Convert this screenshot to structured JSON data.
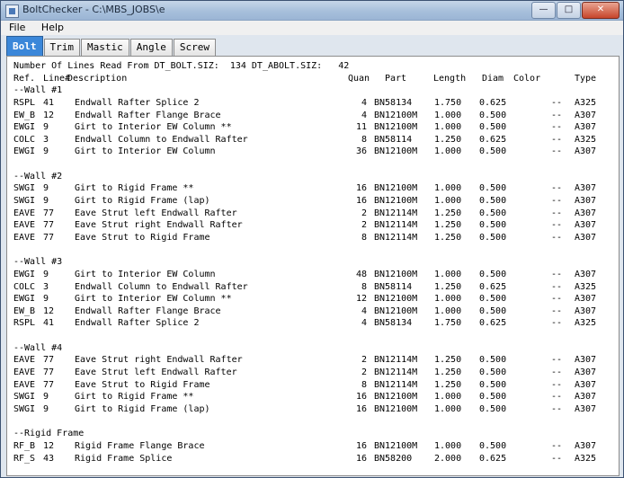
{
  "window": {
    "title": "BoltChecker - C:\\MBS_JOBS\\e"
  },
  "menu": [
    "File",
    "Help"
  ],
  "tabs": [
    "Bolt",
    "Trim",
    "Mastic",
    "Angle",
    "Screw"
  ],
  "info_line": "Number Of Lines Read From DT_BOLT.SIZ:  134 DT_ABOLT.SIZ:   42",
  "headers": {
    "ref": "Ref.",
    "line": "Line#",
    "desc": "Description",
    "quan": "Quan",
    "part": "Part",
    "length": "Length",
    "diam": "Diam",
    "color": "Color",
    "type": "Type"
  },
  "rows": [
    {
      "section": "--Wall #1"
    },
    {
      "ref": "RSPL",
      "line": "41",
      "desc": "Endwall Rafter Splice 2",
      "quan": "4",
      "part": "BN58134",
      "length": "1.750",
      "diam": "0.625",
      "color": "--",
      "type": "A325"
    },
    {
      "ref": "EW_B",
      "line": "12",
      "desc": "Endwall Rafter Flange Brace",
      "quan": "4",
      "part": "BN12100M",
      "length": "1.000",
      "diam": "0.500",
      "color": "--",
      "type": "A307"
    },
    {
      "ref": "EWGI",
      "line": "9",
      "desc": "Girt to Interior EW Column **",
      "quan": "11",
      "part": "BN12100M",
      "length": "1.000",
      "diam": "0.500",
      "color": "--",
      "type": "A307"
    },
    {
      "ref": "COLC",
      "line": "3",
      "desc": "Endwall Column to Endwall Rafter",
      "quan": "8",
      "part": "BN58114",
      "length": "1.250",
      "diam": "0.625",
      "color": "--",
      "type": "A325"
    },
    {
      "ref": "EWGI",
      "line": "9",
      "desc": "Girt to Interior EW Column",
      "quan": "36",
      "part": "BN12100M",
      "length": "1.000",
      "diam": "0.500",
      "color": "--",
      "type": "A307"
    },
    {
      "blank": true
    },
    {
      "section": "--Wall #2"
    },
    {
      "ref": "SWGI",
      "line": "9",
      "desc": "Girt to Rigid Frame **",
      "quan": "16",
      "part": "BN12100M",
      "length": "1.000",
      "diam": "0.500",
      "color": "--",
      "type": "A307"
    },
    {
      "ref": "SWGI",
      "line": "9",
      "desc": "Girt to Rigid Frame (lap)",
      "quan": "16",
      "part": "BN12100M",
      "length": "1.000",
      "diam": "0.500",
      "color": "--",
      "type": "A307"
    },
    {
      "ref": "EAVE",
      "line": "77",
      "desc": "Eave Strut left Endwall Rafter",
      "quan": "2",
      "part": "BN12114M",
      "length": "1.250",
      "diam": "0.500",
      "color": "--",
      "type": "A307"
    },
    {
      "ref": "EAVE",
      "line": "77",
      "desc": "Eave Strut right Endwall Rafter",
      "quan": "2",
      "part": "BN12114M",
      "length": "1.250",
      "diam": "0.500",
      "color": "--",
      "type": "A307"
    },
    {
      "ref": "EAVE",
      "line": "77",
      "desc": "Eave Strut to Rigid Frame",
      "quan": "8",
      "part": "BN12114M",
      "length": "1.250",
      "diam": "0.500",
      "color": "--",
      "type": "A307"
    },
    {
      "blank": true
    },
    {
      "section": "--Wall #3"
    },
    {
      "ref": "EWGI",
      "line": "9",
      "desc": "Girt to Interior EW Column",
      "quan": "48",
      "part": "BN12100M",
      "length": "1.000",
      "diam": "0.500",
      "color": "--",
      "type": "A307"
    },
    {
      "ref": "COLC",
      "line": "3",
      "desc": "Endwall Column to Endwall Rafter",
      "quan": "8",
      "part": "BN58114",
      "length": "1.250",
      "diam": "0.625",
      "color": "--",
      "type": "A325"
    },
    {
      "ref": "EWGI",
      "line": "9",
      "desc": "Girt to Interior EW Column **",
      "quan": "12",
      "part": "BN12100M",
      "length": "1.000",
      "diam": "0.500",
      "color": "--",
      "type": "A307"
    },
    {
      "ref": "EW_B",
      "line": "12",
      "desc": "Endwall Rafter Flange Brace",
      "quan": "4",
      "part": "BN12100M",
      "length": "1.000",
      "diam": "0.500",
      "color": "--",
      "type": "A307"
    },
    {
      "ref": "RSPL",
      "line": "41",
      "desc": "Endwall Rafter Splice 2",
      "quan": "4",
      "part": "BN58134",
      "length": "1.750",
      "diam": "0.625",
      "color": "--",
      "type": "A325"
    },
    {
      "blank": true
    },
    {
      "section": "--Wall #4"
    },
    {
      "ref": "EAVE",
      "line": "77",
      "desc": "Eave Strut right Endwall Rafter",
      "quan": "2",
      "part": "BN12114M",
      "length": "1.250",
      "diam": "0.500",
      "color": "--",
      "type": "A307"
    },
    {
      "ref": "EAVE",
      "line": "77",
      "desc": "Eave Strut left Endwall Rafter",
      "quan": "2",
      "part": "BN12114M",
      "length": "1.250",
      "diam": "0.500",
      "color": "--",
      "type": "A307"
    },
    {
      "ref": "EAVE",
      "line": "77",
      "desc": "Eave Strut to Rigid Frame",
      "quan": "8",
      "part": "BN12114M",
      "length": "1.250",
      "diam": "0.500",
      "color": "--",
      "type": "A307"
    },
    {
      "ref": "SWGI",
      "line": "9",
      "desc": "Girt to Rigid Frame **",
      "quan": "16",
      "part": "BN12100M",
      "length": "1.000",
      "diam": "0.500",
      "color": "--",
      "type": "A307"
    },
    {
      "ref": "SWGI",
      "line": "9",
      "desc": "Girt to Rigid Frame (lap)",
      "quan": "16",
      "part": "BN12100M",
      "length": "1.000",
      "diam": "0.500",
      "color": "--",
      "type": "A307"
    },
    {
      "blank": true
    },
    {
      "section": "--Rigid Frame"
    },
    {
      "ref": "RF_B",
      "line": "12",
      "desc": "Rigid Frame Flange Brace",
      "quan": "16",
      "part": "BN12100M",
      "length": "1.000",
      "diam": "0.500",
      "color": "--",
      "type": "A307"
    },
    {
      "ref": "RF_S",
      "line": "43",
      "desc": "Rigid Frame Splice",
      "quan": "16",
      "part": "BN58200",
      "length": "2.000",
      "diam": "0.625",
      "color": "--",
      "type": "A325"
    }
  ]
}
